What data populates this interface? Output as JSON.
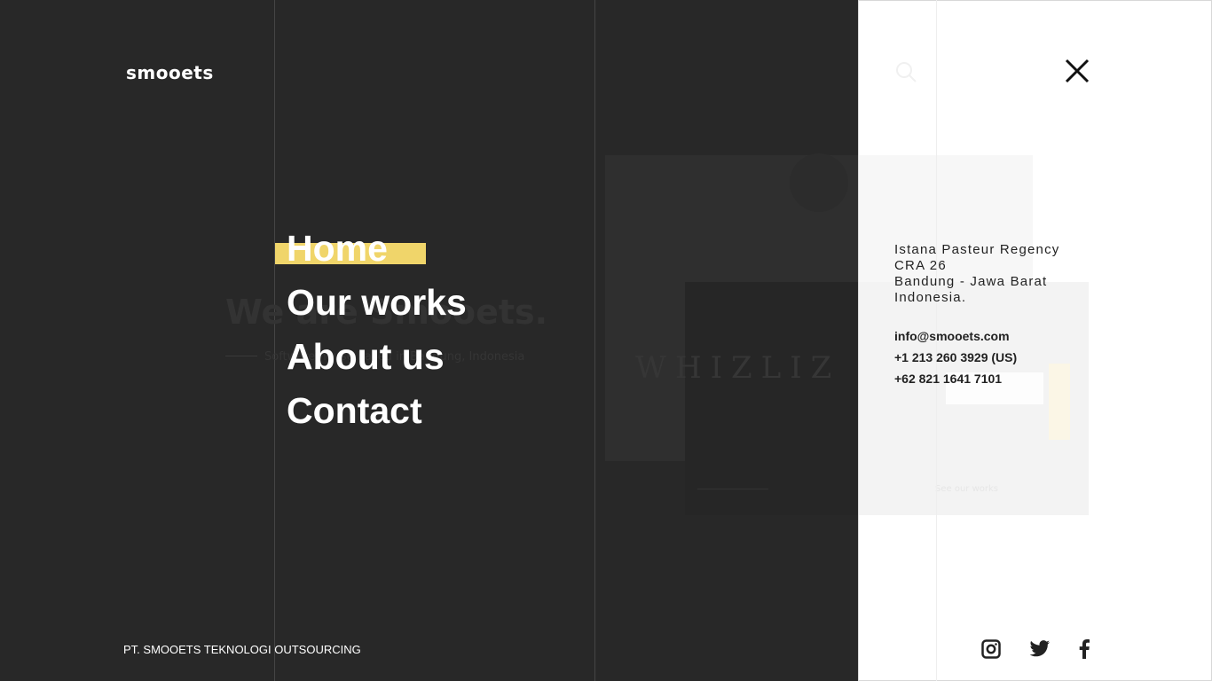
{
  "brand": {
    "logo_text": "smooets"
  },
  "background_page": {
    "heading": "We are Smooets.",
    "subtitle": "Software house based in Bandung, Indonesia",
    "card_brand": "WHIZLIZ",
    "card_link": "See our works"
  },
  "nav": {
    "items": [
      {
        "label": "Home",
        "active": true
      },
      {
        "label": "Our works",
        "active": false
      },
      {
        "label": "About us",
        "active": false
      },
      {
        "label": "Contact",
        "active": false
      }
    ]
  },
  "footer": {
    "company": "PT. SMOOETS TEKNOLOGI OUTSOURCING"
  },
  "panel": {
    "address": {
      "line1": "Istana Pasteur Regency",
      "line2": "CRA 26",
      "line3": "Bandung - Jawa Barat",
      "line4": "Indonesia."
    },
    "contacts": {
      "email": "info@smooets.com",
      "phone_us": "+1 213 260 3929 (US)",
      "phone_id": "+62 821 1641 7101"
    },
    "icons": {
      "search": "search-icon",
      "close": "close-icon",
      "instagram": "instagram-icon",
      "twitter": "twitter-icon",
      "facebook": "facebook-icon"
    }
  },
  "colors": {
    "background": "#282828",
    "accent": "#f0d56a",
    "panel": "#ffffff",
    "text_light": "#ffffff",
    "text_dark": "#222222"
  }
}
